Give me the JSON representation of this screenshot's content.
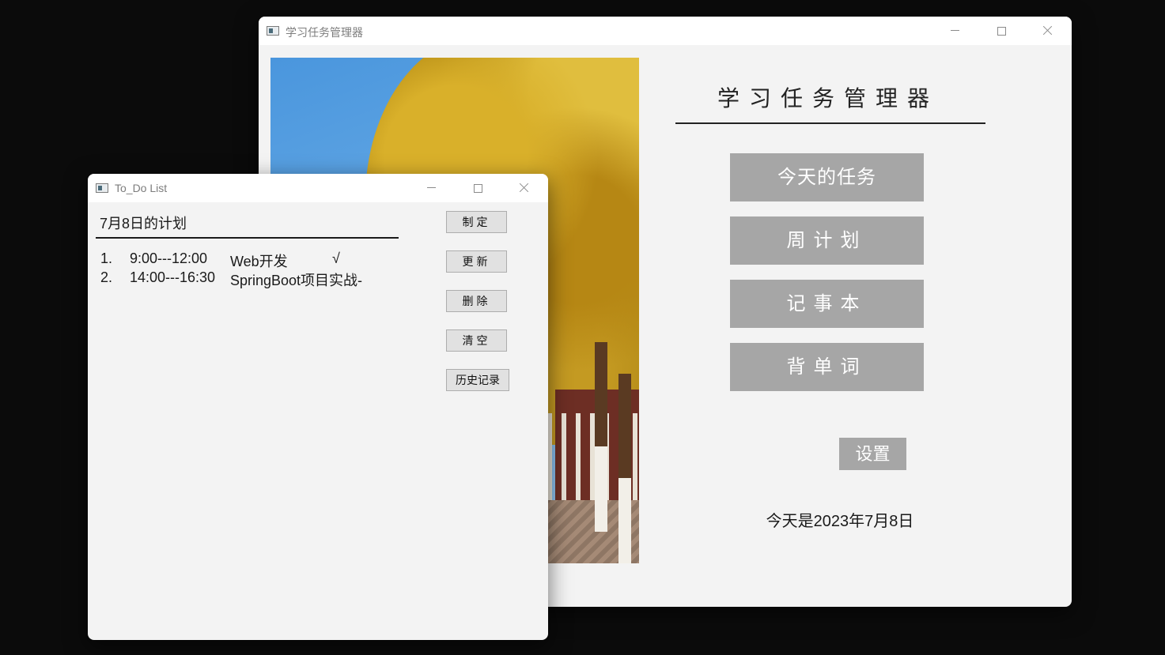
{
  "main_window": {
    "title": "学习任务管理器",
    "heading": "学习任务管理器",
    "buttons": {
      "today_tasks": "今天的任务",
      "weekly_plan": "周计划",
      "notebook": "记事本",
      "vocabulary": "背单词"
    },
    "settings_label": "设置",
    "date_text": "今天是2023年7月8日"
  },
  "todo_window": {
    "title": "To_Do List",
    "heading": "7月8日的计划",
    "tasks": [
      {
        "index": "1.",
        "time": "9:00---12:00",
        "name": "Web开发",
        "mark": "√"
      },
      {
        "index": "2.",
        "time": "14:00---16:30",
        "name": "SpringBoot项目实战-",
        "mark": ""
      }
    ],
    "buttons": {
      "create": "制定",
      "update": "更新",
      "delete": "删除",
      "clear": "清空",
      "history": "历史记录"
    }
  },
  "colors": {
    "desktop_bg": "#0b0b0b",
    "window_bg": "#f3f3f3",
    "menu_button_bg": "#a6a6a6",
    "side_button_bg": "#e1e1e1"
  }
}
